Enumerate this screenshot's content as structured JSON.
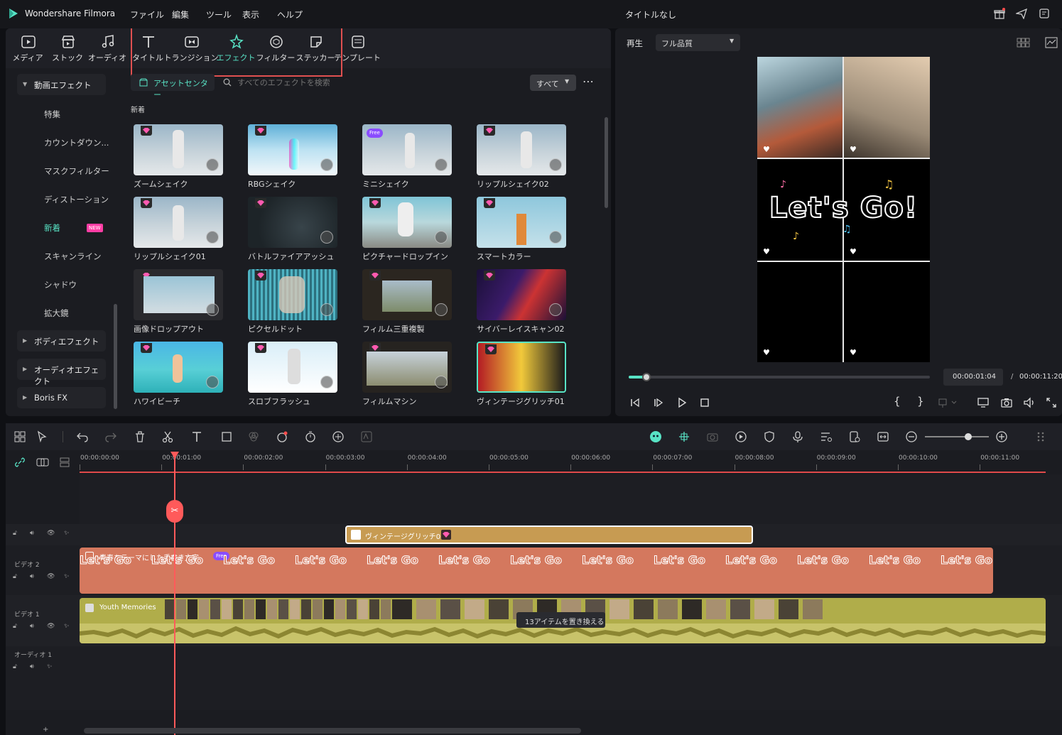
{
  "app": {
    "name": "Wondershare Filmora",
    "doc_title": "タイトルなし"
  },
  "menu": [
    "ファイル",
    "編集",
    "ツール",
    "表示",
    "ヘルプ"
  ],
  "tabs": [
    {
      "label": "メディア",
      "icon": "media-icon"
    },
    {
      "label": "ストック",
      "icon": "stock-icon"
    },
    {
      "label": "オーディオ",
      "icon": "audio-icon"
    },
    {
      "label": "タイトル",
      "icon": "title-icon"
    },
    {
      "label": "トランジション",
      "icon": "transition-icon"
    },
    {
      "label": "エフェクト",
      "icon": "effect-icon",
      "active": true
    },
    {
      "label": "フィルター",
      "icon": "filter-icon"
    },
    {
      "label": "ステッカー",
      "icon": "sticker-icon"
    },
    {
      "label": "テンプレート",
      "icon": "template-icon"
    }
  ],
  "sidebar": {
    "group_video": "動画エフェクト",
    "items": [
      "特集",
      "カウントダウン...",
      "マスクフィルター",
      "ディストーション",
      "新着",
      "スキャンライン",
      "シャドウ",
      "拡大鏡"
    ],
    "new_badge": "NEW",
    "group_body": "ボディエフェクト",
    "group_audio": "オーディオエフェクト",
    "group_boris": "Boris FX"
  },
  "effects_toolbar": {
    "asset_center": "アセットセンター",
    "search_placeholder": "すべてのエフェクトを検索",
    "filter": "すべて",
    "section": "新着"
  },
  "effects": [
    {
      "label": "ズームシェイク",
      "badge": "gem"
    },
    {
      "label": "RBGシェイク",
      "badge": "gem"
    },
    {
      "label": "ミニシェイク",
      "badge": "Free"
    },
    {
      "label": "リップルシェイク02",
      "badge": "gem"
    },
    {
      "label": "リップルシェイク01",
      "badge": "gem"
    },
    {
      "label": "バトルファイアアッシュ",
      "badge": "gem"
    },
    {
      "label": "ピクチャードロップイン",
      "badge": "gem"
    },
    {
      "label": "スマートカラー",
      "badge": "gem"
    },
    {
      "label": "画像ドロップアウト",
      "badge": "gem"
    },
    {
      "label": "ピクセルドット",
      "badge": "gem"
    },
    {
      "label": "フィルム三重複製",
      "badge": "gem"
    },
    {
      "label": "サイバーレイスキャン02",
      "badge": "gem"
    },
    {
      "label": "ハワイビーチ",
      "badge": "gem"
    },
    {
      "label": "スロブフラッシュ",
      "badge": "gem"
    },
    {
      "label": "フィルムマシン",
      "badge": "gem"
    },
    {
      "label": "ヴィンテージグリッチ01",
      "badge": "gem"
    }
  ],
  "preview": {
    "play_label": "再生",
    "quality": "フル品質",
    "overlay_text": "Let's Go!",
    "current_time": "00:00:01:04",
    "separator": "/",
    "total_time": "00:00:11:20",
    "progress": 0.06
  },
  "timeline": {
    "ruler": [
      "00:00:00:00",
      "00:00:01:00",
      "00:00:02:00",
      "00:00:03:00",
      "00:00:04:00",
      "00:00:05:00",
      "00:00:06:00",
      "00:00:07:00",
      "00:00:08:00",
      "00:00:09:00",
      "00:00:10:00",
      "00:00:11:00"
    ],
    "effect_clip": "ヴィンテージグリッチ01",
    "title_clip_label": "青春をテーマにした手書き文字",
    "title_clip_text": "Let's Go",
    "free_badge": "Free",
    "video_clip": "Youth Memories",
    "tooltip": "13アイテムを置き換える",
    "tracks": [
      "ビデオ 2",
      "ビデオ 1",
      "オーディオ 1"
    ]
  },
  "colors": {
    "accent": "#58e3c5",
    "effect_clip": "#c79b52",
    "title_clip": "#d4785e",
    "video_clip": "#b0ad4a",
    "playhead": "#ff5a5a"
  }
}
